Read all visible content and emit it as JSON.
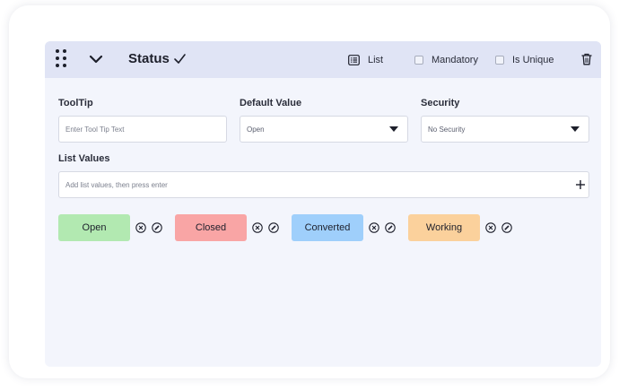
{
  "header": {
    "title": "Status",
    "list_label": "List",
    "mandatory_label": "Mandatory",
    "is_unique_label": "Is Unique"
  },
  "form": {
    "tooltip": {
      "label": "ToolTip",
      "placeholder": "Enter Tool Tip Text"
    },
    "default_value": {
      "label": "Default Value",
      "selected": "Open"
    },
    "security": {
      "label": "Security",
      "selected": "No Security"
    },
    "list_values": {
      "label": "List Values",
      "placeholder": "Add list values, then press enter"
    }
  },
  "chips": [
    {
      "label": "Open",
      "color": "#b2e9b1"
    },
    {
      "label": "Closed",
      "color": "#f9a5a5"
    },
    {
      "label": "Converted",
      "color": "#9fcffb"
    },
    {
      "label": "Working",
      "color": "#fbd19c"
    }
  ],
  "icons": {
    "drag": "drag-handle-icon",
    "collapse": "chevron-down-icon",
    "confirm": "check-icon",
    "list": "list-icon",
    "delete": "trash-icon",
    "add": "plus-icon",
    "remove": "close-circle-icon",
    "edit": "edit-icon"
  }
}
